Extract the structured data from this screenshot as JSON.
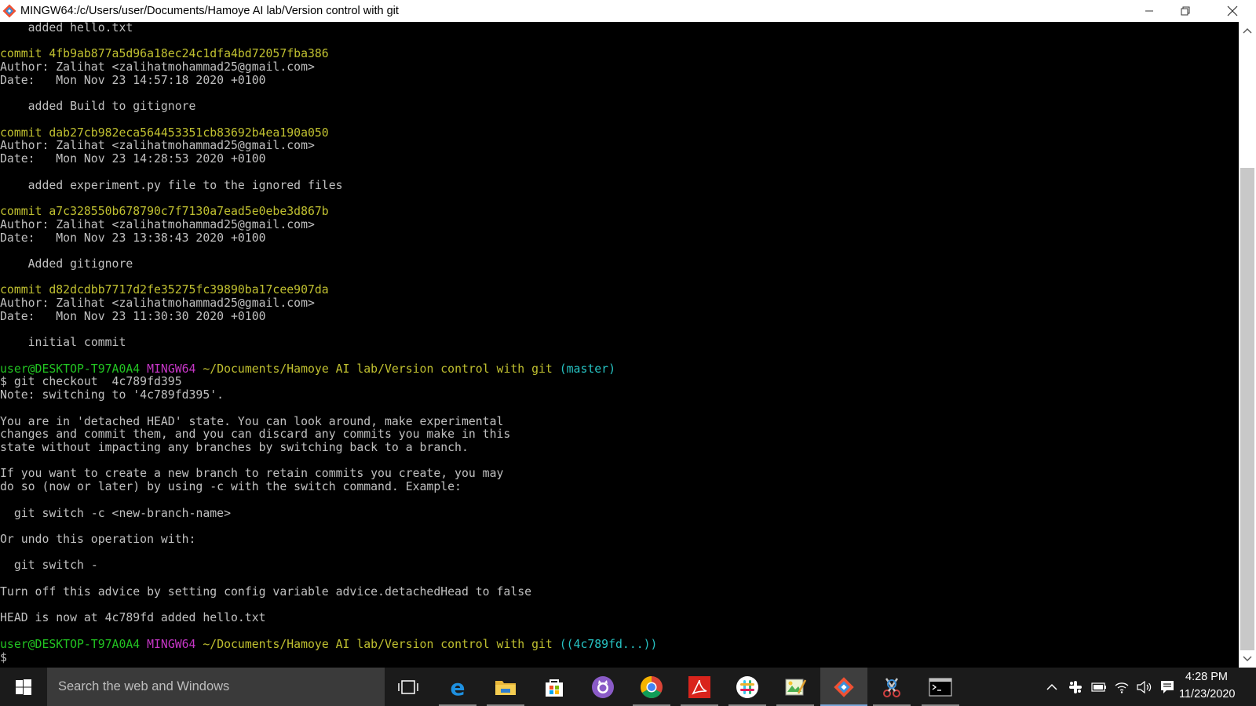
{
  "window": {
    "title": "MINGW64:/c/Users/user/Documents/Hamoye AI lab/Version control with git"
  },
  "terminal": {
    "lines": [
      {
        "indent": "    ",
        "text": "added hello.txt"
      },
      {
        "text": ""
      },
      {
        "text": "commit 4fb9ab877a5d96a18ec24c1dfa4bd72057fba386",
        "color": "yellow"
      },
      {
        "text": "Author: Zalihat <zalihatmohammad25@gmail.com>"
      },
      {
        "text": "Date:   Mon Nov 23 14:57:18 2020 +0100"
      },
      {
        "text": ""
      },
      {
        "indent": "    ",
        "text": "added Build to gitignore"
      },
      {
        "text": ""
      },
      {
        "text": "commit dab27cb982eca564453351cb83692b4ea190a050",
        "color": "yellow"
      },
      {
        "text": "Author: Zalihat <zalihatmohammad25@gmail.com>"
      },
      {
        "text": "Date:   Mon Nov 23 14:28:53 2020 +0100"
      },
      {
        "text": ""
      },
      {
        "indent": "    ",
        "text": "added experiment.py file to the ignored files"
      },
      {
        "text": ""
      },
      {
        "text": "commit a7c328550b678790c7f7130a7ead5e0ebe3d867b",
        "color": "yellow"
      },
      {
        "text": "Author: Zalihat <zalihatmohammad25@gmail.com>"
      },
      {
        "text": "Date:   Mon Nov 23 13:38:43 2020 +0100"
      },
      {
        "text": ""
      },
      {
        "indent": "    ",
        "text": "Added gitignore"
      },
      {
        "text": ""
      },
      {
        "text": "commit d82dcdbb7717d2fe35275fc39890ba17cee907da",
        "color": "yellow"
      },
      {
        "text": "Author: Zalihat <zalihatmohammad25@gmail.com>"
      },
      {
        "text": "Date:   Mon Nov 23 11:30:30 2020 +0100"
      },
      {
        "text": ""
      },
      {
        "indent": "    ",
        "text": "initial commit"
      },
      {
        "text": ""
      },
      {
        "prompt": true,
        "user": "user@DESKTOP-T97A0A4",
        "system": "MINGW64",
        "path": "~/Documents/Hamoye AI lab/Version control with git",
        "branch": "(master)"
      },
      {
        "text": "$ git checkout  4c789fd395"
      },
      {
        "text": "Note: switching to '4c789fd395'."
      },
      {
        "text": ""
      },
      {
        "text": "You are in 'detached HEAD' state. You can look around, make experimental"
      },
      {
        "text": "changes and commit them, and you can discard any commits you make in this"
      },
      {
        "text": "state without impacting any branches by switching back to a branch."
      },
      {
        "text": ""
      },
      {
        "text": "If you want to create a new branch to retain commits you create, you may"
      },
      {
        "text": "do so (now or later) by using -c with the switch command. Example:"
      },
      {
        "text": ""
      },
      {
        "indent": "  ",
        "text": "git switch -c <new-branch-name>"
      },
      {
        "text": ""
      },
      {
        "text": "Or undo this operation with:"
      },
      {
        "text": ""
      },
      {
        "indent": "  ",
        "text": "git switch -"
      },
      {
        "text": ""
      },
      {
        "text": "Turn off this advice by setting config variable advice.detachedHead to false"
      },
      {
        "text": ""
      },
      {
        "text": "HEAD is now at 4c789fd added hello.txt"
      },
      {
        "text": ""
      },
      {
        "prompt": true,
        "user": "user@DESKTOP-T97A0A4",
        "system": "MINGW64",
        "path": "~/Documents/Hamoye AI lab/Version control with git",
        "branch": "((4c789fd...))"
      },
      {
        "text": "$"
      }
    ]
  },
  "taskbar": {
    "search_placeholder": "Search the web and Windows",
    "apps": [
      {
        "name": "task-view-icon"
      },
      {
        "name": "edge-icon",
        "running": true
      },
      {
        "name": "file-explorer-icon",
        "running": true
      },
      {
        "name": "store-icon"
      },
      {
        "name": "github-desktop-icon"
      },
      {
        "name": "chrome-icon",
        "running": true
      },
      {
        "name": "acrobat-icon",
        "running": true
      },
      {
        "name": "slack-icon",
        "running": true
      },
      {
        "name": "paint-icon",
        "running": true
      },
      {
        "name": "git-bash-icon",
        "running": true,
        "active": true
      },
      {
        "name": "snipping-tool-icon",
        "running": true
      },
      {
        "name": "command-prompt-icon",
        "running": true
      }
    ],
    "clock": {
      "time": "4:28 PM",
      "date": "11/23/2020"
    }
  },
  "colors": {
    "commit_hash": "#c0c030",
    "prompt_user": "#22c422",
    "prompt_system": "#c636c6",
    "prompt_branch": "#27c4c4",
    "text": "#c0c0c0",
    "background": "#000000"
  }
}
